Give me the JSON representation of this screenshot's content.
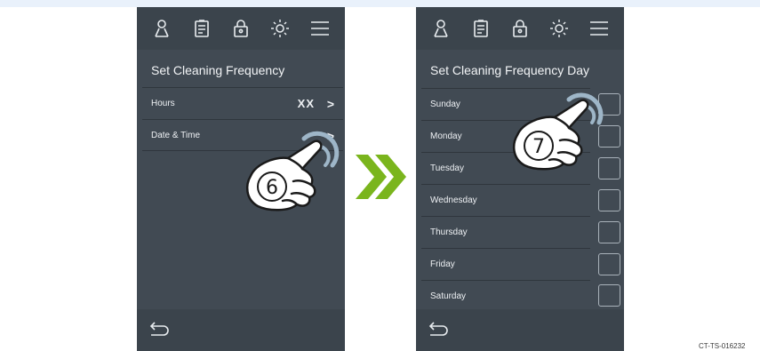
{
  "screens": [
    {
      "title": "Set Cleaning Frequency",
      "rows": [
        {
          "label": "Hours",
          "value": "XX",
          "chevron": ">"
        },
        {
          "label": "Date & Time",
          "chevron": ">"
        }
      ],
      "step_number": "6"
    },
    {
      "title": "Set Cleaning Frequency Day",
      "days": [
        "Sunday",
        "Monday",
        "Tuesday",
        "Wednesday",
        "Thursday",
        "Friday",
        "Saturday"
      ],
      "step_number": "7"
    }
  ],
  "topbar_icons": [
    "user-icon",
    "document-icon",
    "lock-icon",
    "brightness-icon",
    "menu-icon"
  ],
  "bottom_icons": [
    "back-icon"
  ],
  "colors": {
    "panel_bg": "#414a53",
    "bar_bg": "#3b444c",
    "text": "#f2f4f6",
    "arrow_green": "#7ab51d",
    "band": "#e9f1fb"
  },
  "figure_code": "CT-TS-016232"
}
